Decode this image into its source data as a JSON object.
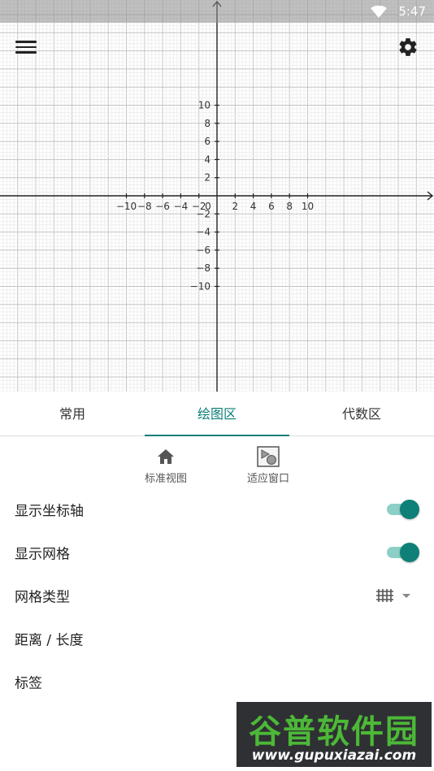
{
  "status_bar": {
    "time": "5:47",
    "wifi_icon": "wifi-icon"
  },
  "toolbar": {
    "menu_icon": "hamburger-menu-icon",
    "settings_icon": "gear-icon"
  },
  "graph": {
    "x_ticks": [
      -10,
      -8,
      -6,
      -4,
      -2,
      0,
      2,
      4,
      6,
      8,
      10
    ],
    "y_ticks": [
      10,
      8,
      6,
      4,
      2,
      -2,
      -4,
      -6,
      -8,
      -10
    ],
    "xlim": [
      -12,
      12
    ],
    "ylim": [
      -11,
      11
    ],
    "grid": true,
    "minor_grid_per_major": 5,
    "axes_visible": true
  },
  "tabs": [
    {
      "label": "常用",
      "active": false
    },
    {
      "label": "绘图区",
      "active": true
    },
    {
      "label": "代数区",
      "active": false
    }
  ],
  "view_buttons": {
    "standard_view": {
      "label": "标准视图",
      "icon": "home-icon"
    },
    "fit_window": {
      "label": "适应窗口",
      "icon": "fit-window-icon"
    }
  },
  "settings": {
    "show_axes": {
      "label": "显示坐标轴",
      "value": true
    },
    "show_grid": {
      "label": "显示网格",
      "value": true
    },
    "grid_type": {
      "label": "网格类型",
      "icon": "grid-type-icon"
    },
    "distance": {
      "label": "距离 / 长度"
    },
    "labeling": {
      "label": "标签"
    }
  },
  "watermark": {
    "title": "谷普软件园",
    "url": "www.gupuxiazai.com"
  },
  "colors": {
    "accent": "#0a7d76",
    "toggle_track": "#8ccfc7",
    "toggle_thumb": "#0e8077"
  }
}
